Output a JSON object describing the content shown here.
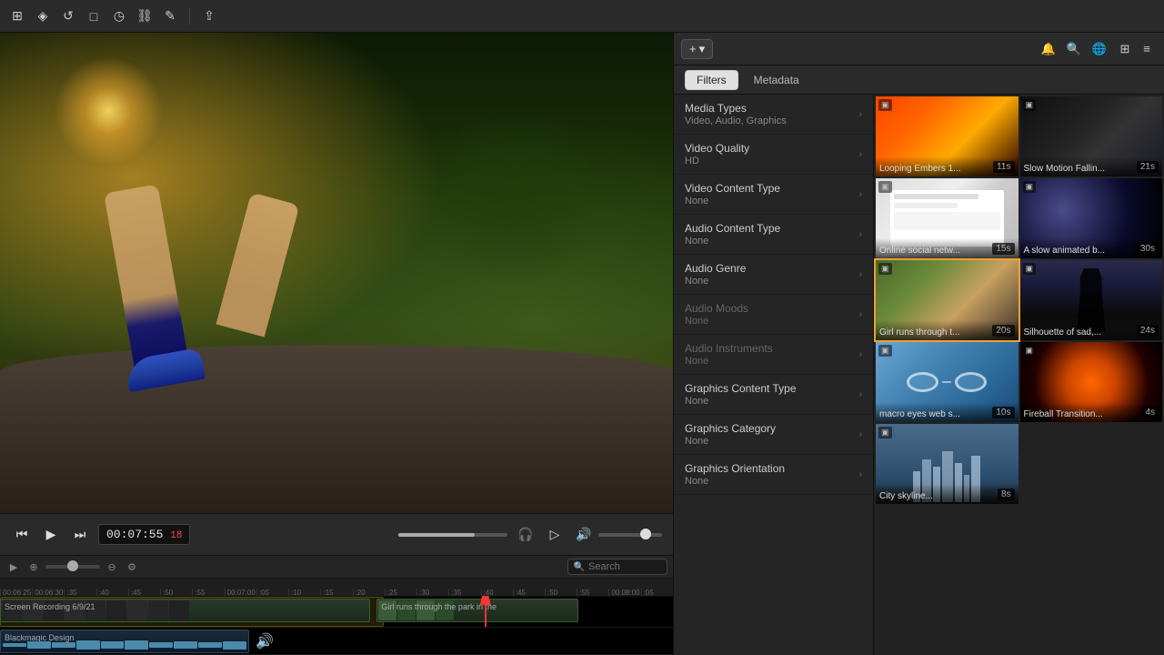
{
  "toolbar": {
    "icons": [
      "grid",
      "eye",
      "refresh",
      "monitor",
      "clock",
      "link",
      "pencil",
      "divider",
      "share"
    ],
    "add_label": "+",
    "add_chevron": "▾"
  },
  "left_panel": {
    "timecode": "00:07:55",
    "timecode_frames": "18",
    "playback_speed_label": ""
  },
  "timeline": {
    "ruler_marks": [
      "00:06:25",
      "00:06:30",
      "00:06:35",
      "00:06:40",
      "00:06:45",
      "00:06:50",
      "00:06:55",
      "00:07:00",
      "00:07:05",
      "00:07:10",
      "00:07:15",
      "00:07:20",
      "00:07:25",
      "00:07:30",
      "00:07:35",
      "00:07:40",
      "00:07:45",
      "00:07:50",
      "00:07:55",
      "00:08:00",
      "00:08:05"
    ],
    "video_track_label": "Screen Recording 6/9/21",
    "video_track2_label": "Girl runs through the park in the",
    "audio_track_label": "Blackmagic Design"
  },
  "right_panel": {
    "toolbar_icons": [
      "bell",
      "search",
      "globe",
      "grid",
      "list"
    ],
    "tabs": [
      {
        "label": "Filters",
        "active": true
      },
      {
        "label": "Metadata",
        "active": false
      }
    ],
    "filters": [
      {
        "name": "Media Types",
        "value": "Video, Audio, Graphics",
        "chevron": "›",
        "dimmed": false
      },
      {
        "name": "Video Quality",
        "value": "HD",
        "chevron": "›",
        "dimmed": false
      },
      {
        "name": "Video Content Type",
        "value": "None",
        "chevron": "›",
        "dimmed": false
      },
      {
        "name": "Audio Content Type",
        "value": "None",
        "chevron": "›",
        "dimmed": false
      },
      {
        "name": "Audio Genre",
        "value": "None",
        "chevron": "›",
        "dimmed": false
      },
      {
        "name": "Audio Moods",
        "value": "None",
        "chevron": "›",
        "dimmed": true
      },
      {
        "name": "Audio Instruments",
        "value": "None",
        "chevron": "›",
        "dimmed": true
      },
      {
        "name": "Graphics Content Type",
        "value": "None",
        "chevron": "›",
        "dimmed": false
      },
      {
        "name": "Graphics Category",
        "value": "None",
        "chevron": "›",
        "dimmed": false
      },
      {
        "name": "Graphics Orientation",
        "value": "None",
        "chevron": "›",
        "dimmed": false
      }
    ],
    "media_items": [
      {
        "id": "embers",
        "title": "Looping Embers 1...",
        "duration": "11s",
        "thumb_class": "thumb-embers",
        "selected": false,
        "badge": "▣"
      },
      {
        "id": "slowmo",
        "title": "Slow Motion Fallin...",
        "duration": "21s",
        "thumb_class": "thumb-slowmo",
        "selected": false,
        "badge": "▣"
      },
      {
        "id": "social",
        "title": "Online social netw...",
        "duration": "15s",
        "thumb_class": "thumb-social",
        "selected": false,
        "badge": "▣"
      },
      {
        "id": "space",
        "title": "A slow animated b...",
        "duration": "30s",
        "thumb_class": "thumb-space",
        "selected": false,
        "badge": "▣"
      },
      {
        "id": "runner",
        "title": "Girl runs through t...",
        "duration": "20s",
        "thumb_class": "thumb-runner",
        "selected": true,
        "badge": "▣"
      },
      {
        "id": "silhouette",
        "title": "Silhouette of sad,...",
        "duration": "24s",
        "thumb_class": "thumb-silhouette",
        "selected": false,
        "badge": "▣"
      },
      {
        "id": "glasses",
        "title": "macro eyes web s...",
        "duration": "10s",
        "thumb_class": "thumb-glasses",
        "selected": false,
        "badge": "▣"
      },
      {
        "id": "fireball",
        "title": "Fireball Transition...",
        "duration": "4s",
        "thumb_class": "thumb-fireball",
        "selected": false,
        "badge": "▣"
      },
      {
        "id": "city",
        "title": "City skyline...",
        "duration": "8s",
        "thumb_class": "thumb-city",
        "selected": false,
        "badge": "▣"
      }
    ],
    "search_placeholder": "Search"
  }
}
